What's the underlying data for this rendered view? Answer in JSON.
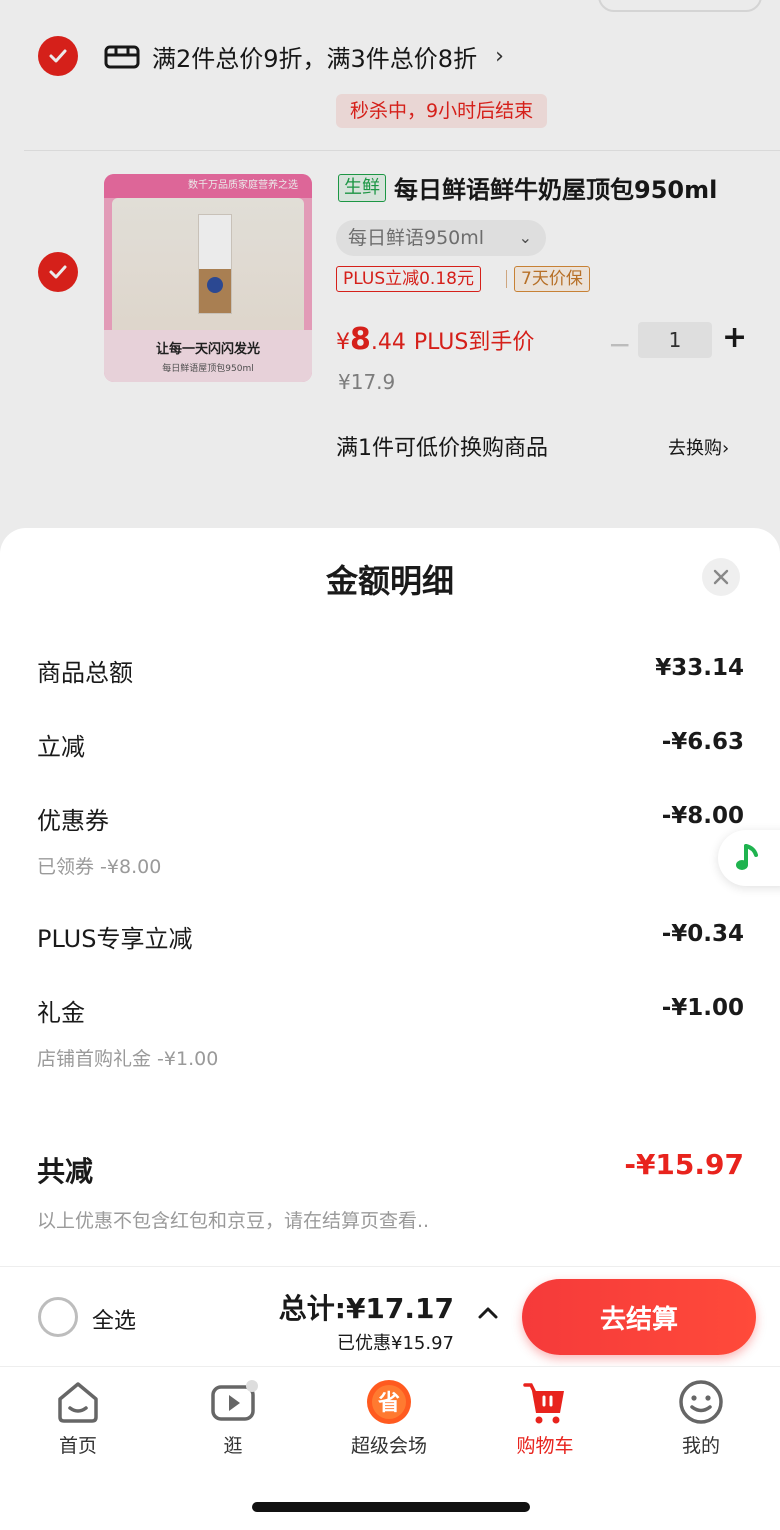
{
  "colors": {
    "accent": "#e8231d",
    "fresh_green": "#1fa34a",
    "guarantee_orange": "#c77a2c"
  },
  "cart_item": {
    "promo_text": "满2件总价9折，满3件总价8折",
    "promo_arrow": "›",
    "flash_sale": "秒杀中，9小时后结束",
    "image_banner": "数千万品质家庭营养之选",
    "image_slogan": "让每一天闪闪发光",
    "image_caption": "每日鲜语屋顶包950ml",
    "fresh_tag": "生鲜",
    "title": "每日鲜语鲜牛奶屋顶包950ml",
    "spec": "每日鲜语950ml",
    "plus_tag": "PLUS立减0.18元",
    "guarantee_tag": "7天价保",
    "price_currency": "¥",
    "price_int": "8",
    "price_dec": ".44",
    "price_suffix": "PLUS到手价",
    "quantity": "1",
    "minus": "−",
    "plus": "+",
    "original_price": "¥17.9",
    "exchange_text": "满1件可低价换购商品",
    "exchange_link": "去换购›"
  },
  "sheet": {
    "title": "金额明细",
    "rows": [
      {
        "label": "商品总额",
        "value": "¥33.14"
      },
      {
        "label": "立减",
        "value": "-¥6.63"
      },
      {
        "label": "优惠券",
        "value": "-¥8.00",
        "sub": "已领券 -¥8.00"
      },
      {
        "label": "PLUS专享立减",
        "value": "-¥0.34"
      },
      {
        "label": "礼金",
        "value": "-¥1.00",
        "sub": "店铺首购礼金 -¥1.00"
      }
    ],
    "total_label": "共减",
    "total_value": "-¥15.97",
    "note": "以上优惠不包含红包和京豆，请在结算页查看.."
  },
  "checkout": {
    "select_all": "全选",
    "total": "总计:¥17.17",
    "saved": "已优惠¥15.97",
    "button": "去结算"
  },
  "tabs": [
    {
      "label": "首页",
      "icon": "home-icon"
    },
    {
      "label": "逛",
      "icon": "video-play-icon"
    },
    {
      "label": "超级会场",
      "icon": "super-venue-icon"
    },
    {
      "label": "购物车",
      "icon": "cart-icon"
    },
    {
      "label": "我的",
      "icon": "profile-smile-icon"
    }
  ],
  "super_venue_glyph": "省"
}
